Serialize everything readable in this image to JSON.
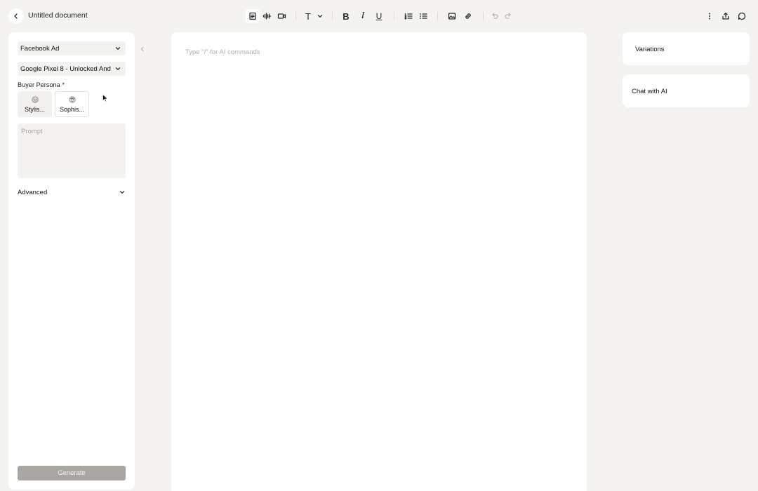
{
  "header": {
    "title": "Untitled document"
  },
  "toolbar": {
    "icons": [
      "document-icon",
      "audio-waveform-icon",
      "video-icon",
      "text-format-icon",
      "chevron-down-icon",
      "bold-icon",
      "italic-icon",
      "underline-icon",
      "numbered-list-icon",
      "bullet-list-icon",
      "image-icon",
      "link-icon",
      "undo-icon",
      "redo-icon",
      "more-vertical-icon",
      "share-icon",
      "comment-icon"
    ],
    "format_text_label": "T",
    "bold_label": "B",
    "italic_label": "I",
    "underline_label": "U"
  },
  "left_panel": {
    "content_type": "Facebook Ad",
    "product": "Google Pixel 8 - Unlocked And",
    "buyer_persona_label": "Buyer Persona *",
    "personas": [
      {
        "label": "Stylis...",
        "selected": true
      },
      {
        "label": "Sophis...",
        "selected": false
      }
    ],
    "prompt_placeholder": "Prompt",
    "advanced_label": "Advanced",
    "generate_label": "Generate"
  },
  "editor": {
    "placeholder": "Type \"/\" for AI commands"
  },
  "right_panel": {
    "variations_label": "Variations",
    "chat_label": "Chat with AI"
  },
  "colors": {
    "background": "#f5f3f0",
    "panel": "#ffffff",
    "field": "#f4f2ef",
    "generate_button": "#aaa7a3"
  }
}
